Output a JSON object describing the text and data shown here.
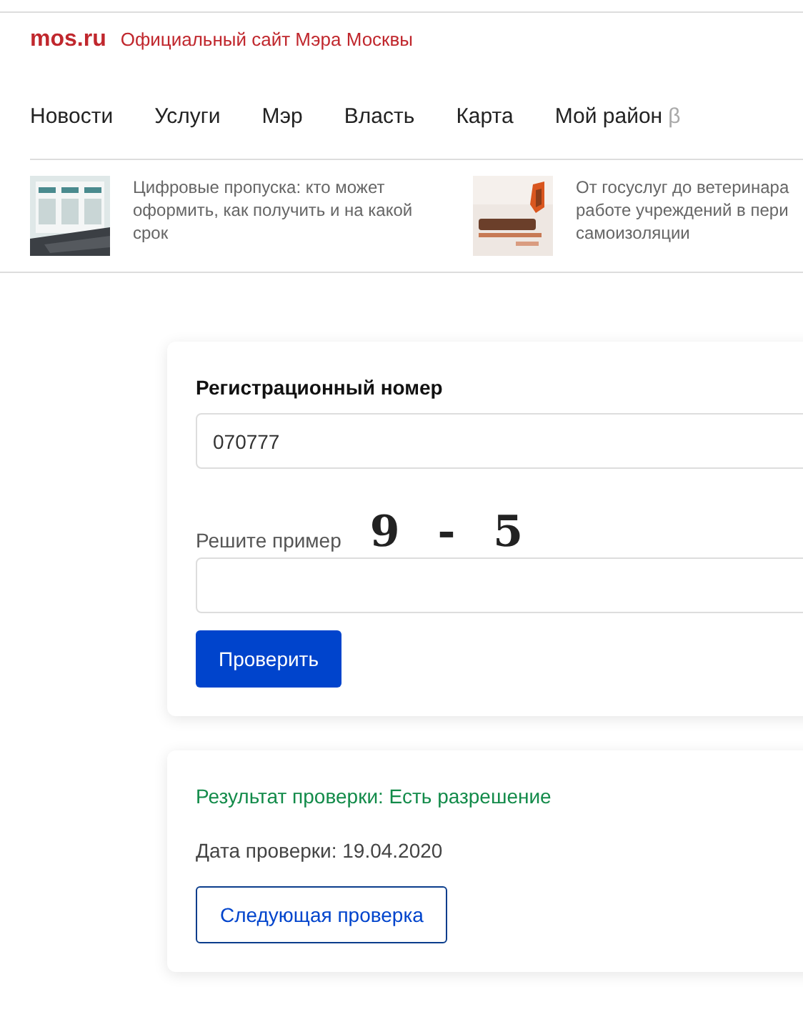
{
  "header": {
    "logo": "mos.ru",
    "tagline": "Официальный сайт Мэра Москвы"
  },
  "nav": [
    {
      "label": "Новости"
    },
    {
      "label": "Услуги"
    },
    {
      "label": "Мэр"
    },
    {
      "label": "Власть"
    },
    {
      "label": "Карта"
    },
    {
      "label": "Мой район",
      "beta": "β"
    }
  ],
  "news": [
    {
      "kind": "laptop",
      "lines": [
        "Цифровые пропуска: кто может",
        "оформить, как получить и на какой",
        "срок"
      ]
    },
    {
      "kind": "sign",
      "lines": [
        "От госуслуг до ветеринара",
        "работе учреждений в пери",
        "самоизоляции"
      ]
    }
  ],
  "form": {
    "reg_label": "Регистрационный номер",
    "reg_value": "070777",
    "captcha_label": "Решите пример",
    "captcha": "9 - 5",
    "button": "Проверить"
  },
  "result": {
    "status": "Результат проверки: Есть разрешение",
    "date": "Дата проверки: 19.04.2020",
    "button": "Следующая проверка"
  }
}
